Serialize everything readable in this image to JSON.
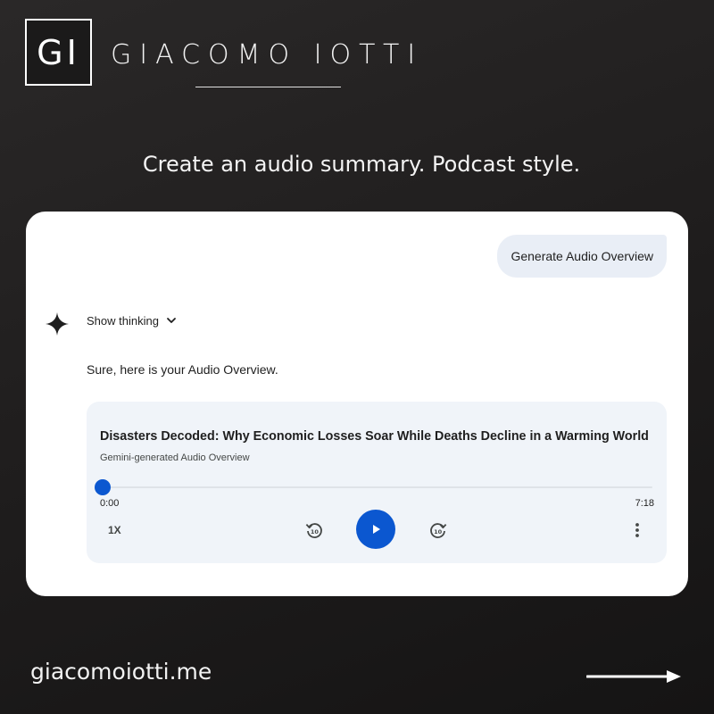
{
  "brand": {
    "logo_initials": "GI",
    "name": "GIACOMO IOTTI"
  },
  "tagline": "Create an audio summary. Podcast style.",
  "chat": {
    "user_message": "Generate Audio Overview",
    "assistant_icon": "sparkle-icon",
    "show_thinking_label": "Show thinking",
    "response_text": "Sure, here is your Audio Overview.",
    "audio_player": {
      "title": "Disasters Decoded: Why Economic Losses Soar While Deaths Decline in a Warming World",
      "subtitle": "Gemini-generated Audio Overview",
      "current_time": "0:00",
      "duration": "7:18",
      "progress_fraction": 0.0,
      "speed_label": "1X",
      "controls": [
        "rewind-10-icon",
        "play-icon",
        "forward-10-icon",
        "more-vert-icon"
      ]
    }
  },
  "footer": {
    "url": "giacomoiotti.me",
    "arrow_icon": "arrow-right-icon"
  },
  "colors": {
    "accent": "#0b57d0",
    "user_bubble": "#e9eef6",
    "audio_card": "#f0f4f9",
    "card_bg": "#ffffff"
  }
}
